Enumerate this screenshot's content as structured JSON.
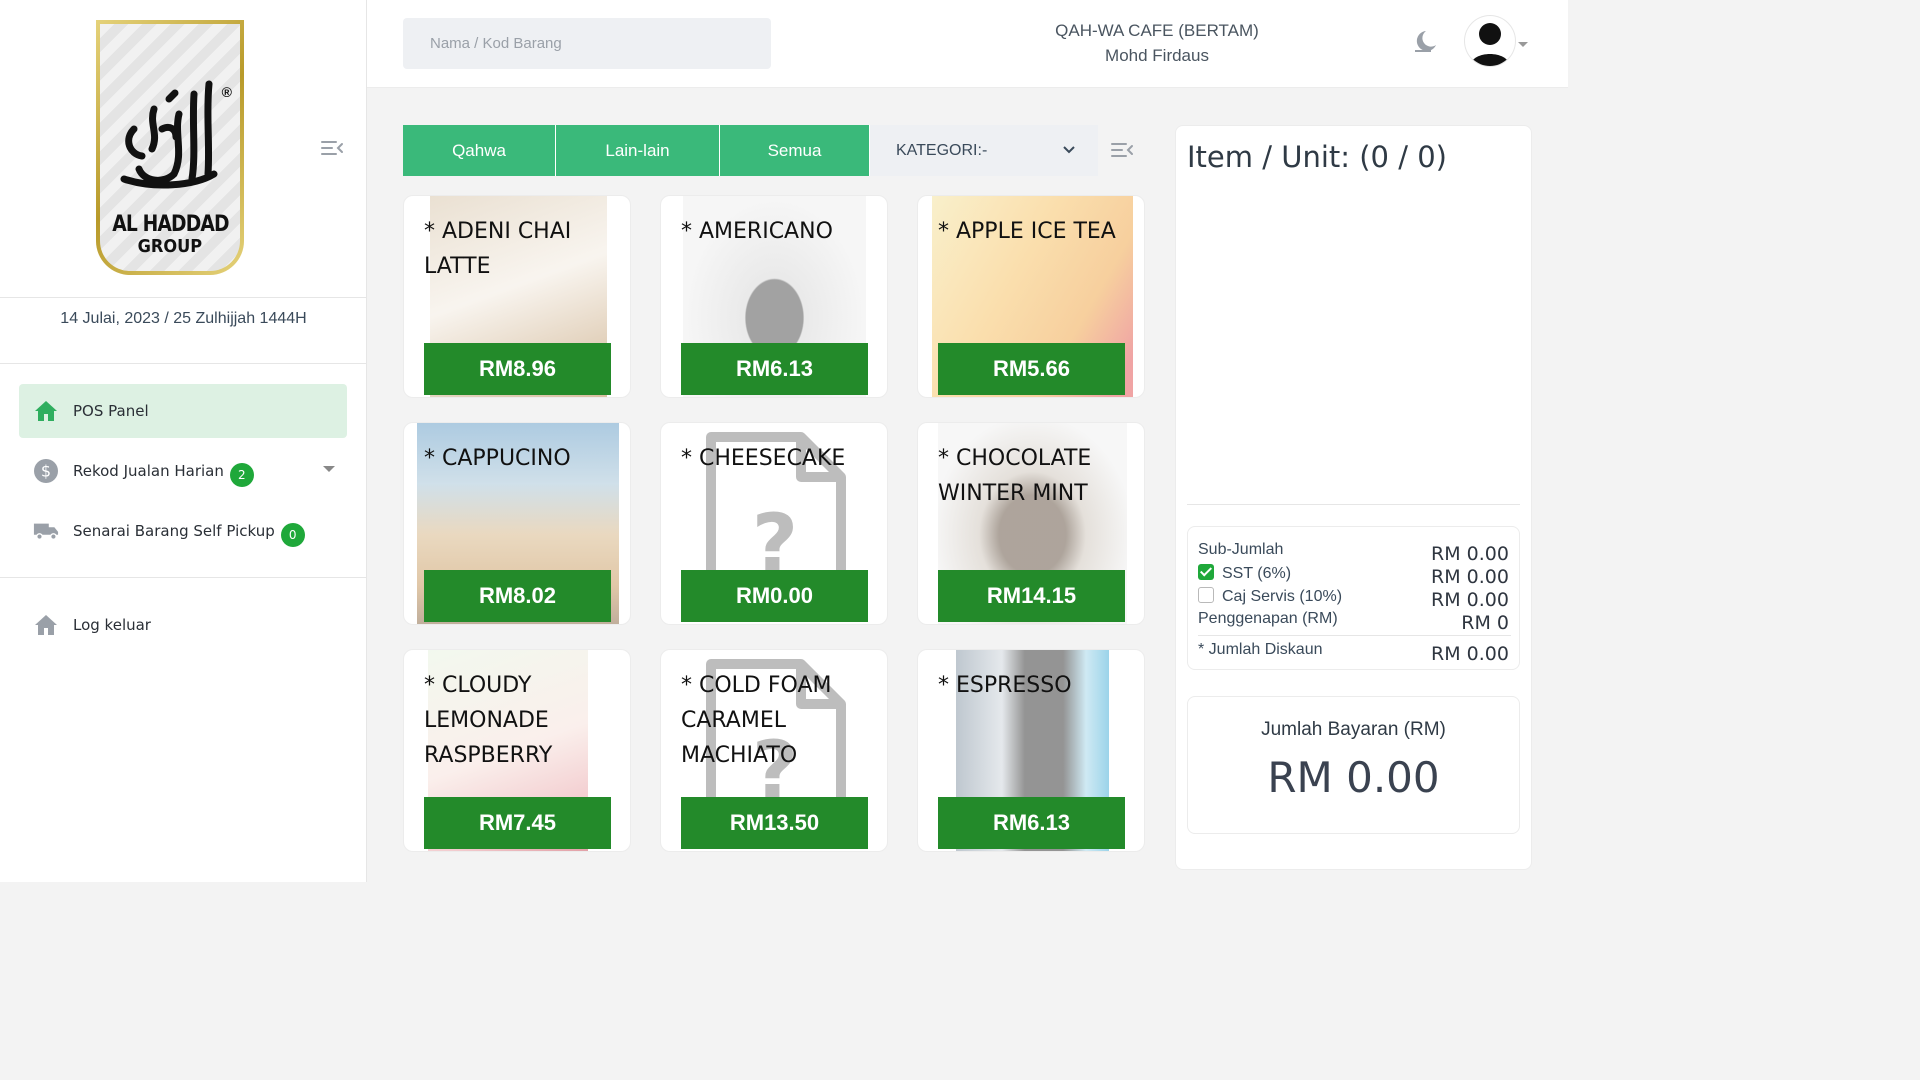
{
  "sidebar": {
    "logo": {
      "line1": "AL HADDAD",
      "line2": "GROUP",
      "reg": "®"
    },
    "date": "14 Julai, 2023 / 25 Zulhijjah 1444H",
    "nav": [
      {
        "label": "POS Panel",
        "icon": "home-icon",
        "active": true
      },
      {
        "label": "Rekod Jualan Harian",
        "icon": "dollar-icon",
        "badge": "2"
      },
      {
        "label": "Senarai Barang Self Pickup",
        "icon": "truck-icon",
        "badge": "0"
      }
    ],
    "logout": {
      "label": "Log keluar",
      "icon": "home-icon"
    }
  },
  "header": {
    "search_placeholder": "Nama / Kod Barang",
    "shop_name": "QAH-WA CAFE (BERTAM)",
    "user_name": "Mohd Firdaus"
  },
  "categories": {
    "tabs": [
      "Qahwa",
      "Lain-lain",
      "Semua"
    ],
    "select_label": "KATEGORI:-"
  },
  "products": [
    {
      "name": "* ADENI CHAI LATTE",
      "price": "RM8.96",
      "image": "drink-photo"
    },
    {
      "name": "* AMERICANO",
      "price": "RM6.13",
      "image": "cup-photo"
    },
    {
      "name": "* APPLE ICE TEA",
      "price": "RM5.66",
      "image": "iced-tea-photo"
    },
    {
      "name": "* CAPPUCINO",
      "price": "RM8.02",
      "image": "cup-photo"
    },
    {
      "name": "* CHEESECAKE",
      "price": "RM0.00",
      "image": "missing-image-icon"
    },
    {
      "name": "* CHOCOLATE WINTER MINT",
      "price": "RM14.15",
      "image": "drink-photo"
    },
    {
      "name": "* CLOUDY LEMONADE RASPBERRY",
      "price": "RM7.45",
      "image": "drink-photo"
    },
    {
      "name": "* COLD FOAM CARAMEL MACHIATO",
      "price": "RM13.50",
      "image": "missing-image-icon"
    },
    {
      "name": "* ESPRESSO",
      "price": "RM6.13",
      "image": "cup-photo"
    }
  ],
  "cart": {
    "title": "Item / Unit: (0 / 0)",
    "summary": {
      "subtotal_label": "Sub-Jumlah",
      "subtotal": "RM 0.00",
      "sst_label": "SST (6%)",
      "sst": "RM 0.00",
      "service_label": "Caj Servis (10%)",
      "service": "RM 0.00",
      "rounding_label": "Penggenapan (RM)",
      "rounding": "RM 0",
      "discount_label": "* Jumlah Diskaun",
      "discount": "RM 0.00"
    },
    "total_label": "Jumlah Bayaran (RM)",
    "total": "RM 0.00"
  },
  "colors": {
    "accent_green": "#3ab97a",
    "price_green": "#238a2a",
    "badge_green": "#1fa83a",
    "active_nav_bg": "#ddf1e3"
  }
}
